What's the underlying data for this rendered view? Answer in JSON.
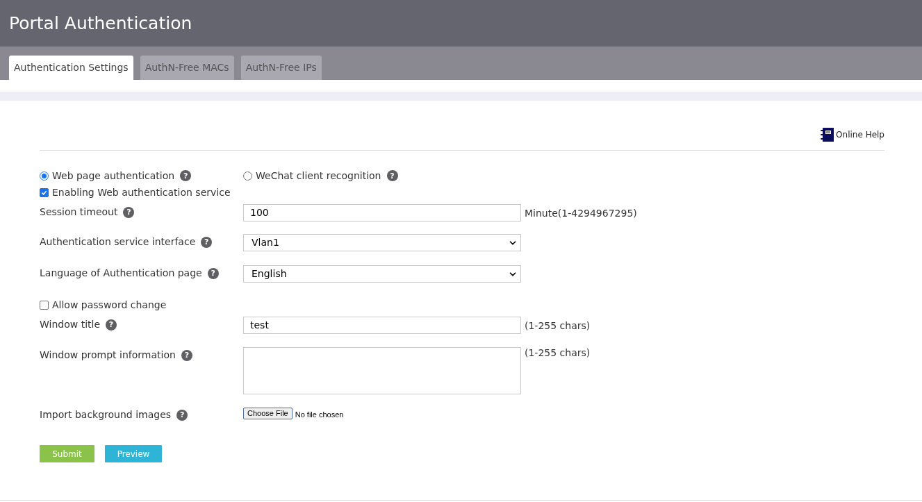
{
  "header": {
    "title": "Portal Authentication"
  },
  "tabs": [
    {
      "label": "Authentication Settings",
      "selected": true
    },
    {
      "label": "AuthN-Free MACs",
      "selected": false
    },
    {
      "label": "AuthN-Free IPs",
      "selected": false
    }
  ],
  "help_link": "Online Help",
  "auth_modes": [
    {
      "label": "Web page authentication",
      "selected": true,
      "help": "?"
    },
    {
      "label": "WeChat client recognition",
      "selected": false,
      "help": "?"
    }
  ],
  "fields": [
    {
      "kind": "checkbox",
      "label": "Enabling Web authentication service",
      "checked": true
    },
    {
      "kind": "text",
      "label": "Session timeout",
      "help": "?",
      "value": "100",
      "hint": "Minute(1-4294967295)"
    },
    {
      "kind": "select",
      "label": "Authentication service interface",
      "help": "?",
      "value": "Vlan1"
    },
    {
      "kind": "select",
      "label": "Language of Authentication page",
      "help": "?",
      "value": "English"
    },
    {
      "kind": "checkbox",
      "label": "Allow password change",
      "checked": false
    },
    {
      "kind": "text",
      "label": "Window title",
      "help": "?",
      "value": "test",
      "hint": "(1-255 chars)"
    },
    {
      "kind": "textarea",
      "label": "Window prompt information",
      "help": "?",
      "hint": "(1-255 chars)"
    },
    {
      "kind": "file",
      "label": "Import background images",
      "help": "?",
      "button": "Choose File",
      "status": "No file chosen"
    }
  ],
  "buttons": [
    {
      "label": "Submit",
      "kind": "primary"
    },
    {
      "label": "Preview",
      "kind": "secondary"
    }
  ]
}
